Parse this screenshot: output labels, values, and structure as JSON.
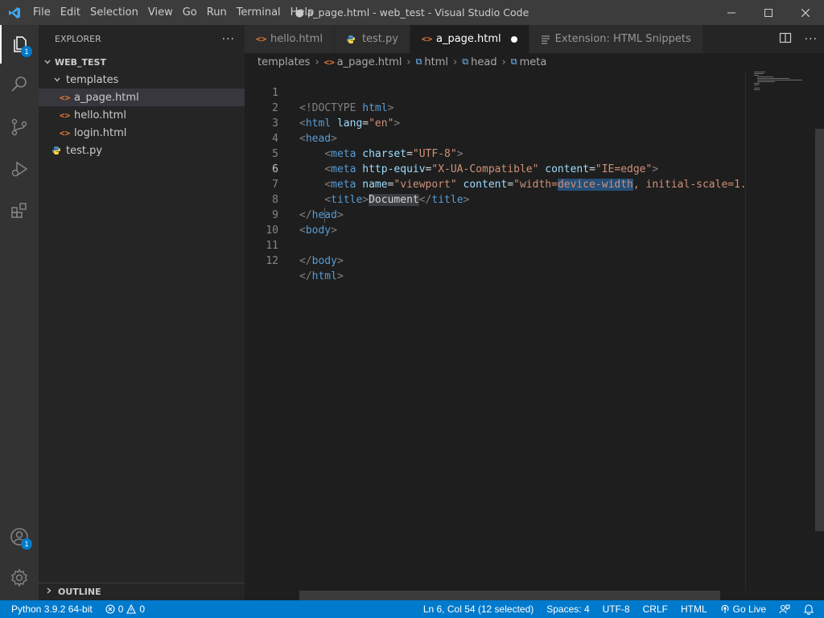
{
  "window": {
    "title": "● a_page.html - web_test - Visual Studio Code",
    "menu": [
      "File",
      "Edit",
      "Selection",
      "View",
      "Go",
      "Run",
      "Terminal",
      "Help"
    ]
  },
  "activity_bar": {
    "explorer_badge": "1",
    "accounts_badge": "1"
  },
  "sidebar": {
    "title": "EXPLORER",
    "more": "···",
    "root": "WEB_TEST",
    "folder": "templates",
    "files": [
      "a_page.html",
      "hello.html",
      "login.html"
    ],
    "root_file": "test.py",
    "outline": "OUTLINE"
  },
  "tabs": [
    {
      "label": "hello.html",
      "icon": "html-file-icon"
    },
    {
      "label": "test.py",
      "icon": "python-file-icon"
    },
    {
      "label": "a_page.html",
      "icon": "html-file-icon",
      "active": true,
      "dirty": true
    },
    {
      "label": "Extension: HTML Snippets",
      "icon": "extension-preview-icon"
    }
  ],
  "breadcrumb": [
    "templates",
    "a_page.html",
    "html",
    "head",
    "meta"
  ],
  "editor": {
    "line_numbers": [
      "1",
      "2",
      "3",
      "4",
      "5",
      "6",
      "7",
      "8",
      "9",
      "10",
      "11",
      "12"
    ],
    "l1": {
      "a": "<!DOCTYPE",
      "b": " html",
      "c": ">"
    },
    "l2": {
      "open": "<",
      "tag": "html",
      "attr": " lang",
      "eq": "=",
      "val": "\"en\"",
      "close": ">"
    },
    "l3": {
      "open": "<",
      "tag": "head",
      "close": ">"
    },
    "l4": {
      "indent": "    ",
      "open": "<",
      "tag": "meta",
      "attr": " charset",
      "eq": "=",
      "val": "\"UTF-8\"",
      "close": ">"
    },
    "l5": {
      "indent": "    ",
      "open": "<",
      "tag": "meta",
      "attr1": " http-equiv",
      "eq1": "=",
      "val1": "\"X-UA-Compatible\"",
      "attr2": " content",
      "eq2": "=",
      "val2": "\"IE=edge\"",
      "close": ">"
    },
    "l6": {
      "indent": "    ",
      "open": "<",
      "tag": "meta",
      "attr1": " name",
      "eq1": "=",
      "val1": "\"viewport\"",
      "attr2": " content",
      "eq2": "=",
      "val2a": "\"width=",
      "val2sel": "device-width",
      "val2b": ", initial-scale=1.0\""
    },
    "l7": {
      "indent": "    ",
      "open": "<",
      "tag": "title",
      "close": ">",
      "text": "Document",
      "open2": "</",
      "tag2": "title",
      "close2": ">"
    },
    "l8": {
      "open": "</",
      "tag": "head",
      "close": ">"
    },
    "l9": {
      "open": "<",
      "tag": "body",
      "close": ">"
    },
    "l11": {
      "open": "</",
      "tag": "body",
      "close": ">"
    },
    "l12": {
      "open": "</",
      "tag": "html",
      "close": ">"
    }
  },
  "status": {
    "python": "Python 3.9.2 64-bit",
    "errors": "0",
    "warnings": "0",
    "cursor": "Ln 6, Col 54 (12 selected)",
    "spaces": "Spaces: 4",
    "encoding": "UTF-8",
    "eol": "CRLF",
    "language": "HTML",
    "golive": "Go Live"
  },
  "colors": {
    "accent": "#007acc",
    "tag": "#569cd6",
    "attr": "#9cdcfe",
    "string": "#ce9178",
    "html_icon": "#e37933"
  }
}
